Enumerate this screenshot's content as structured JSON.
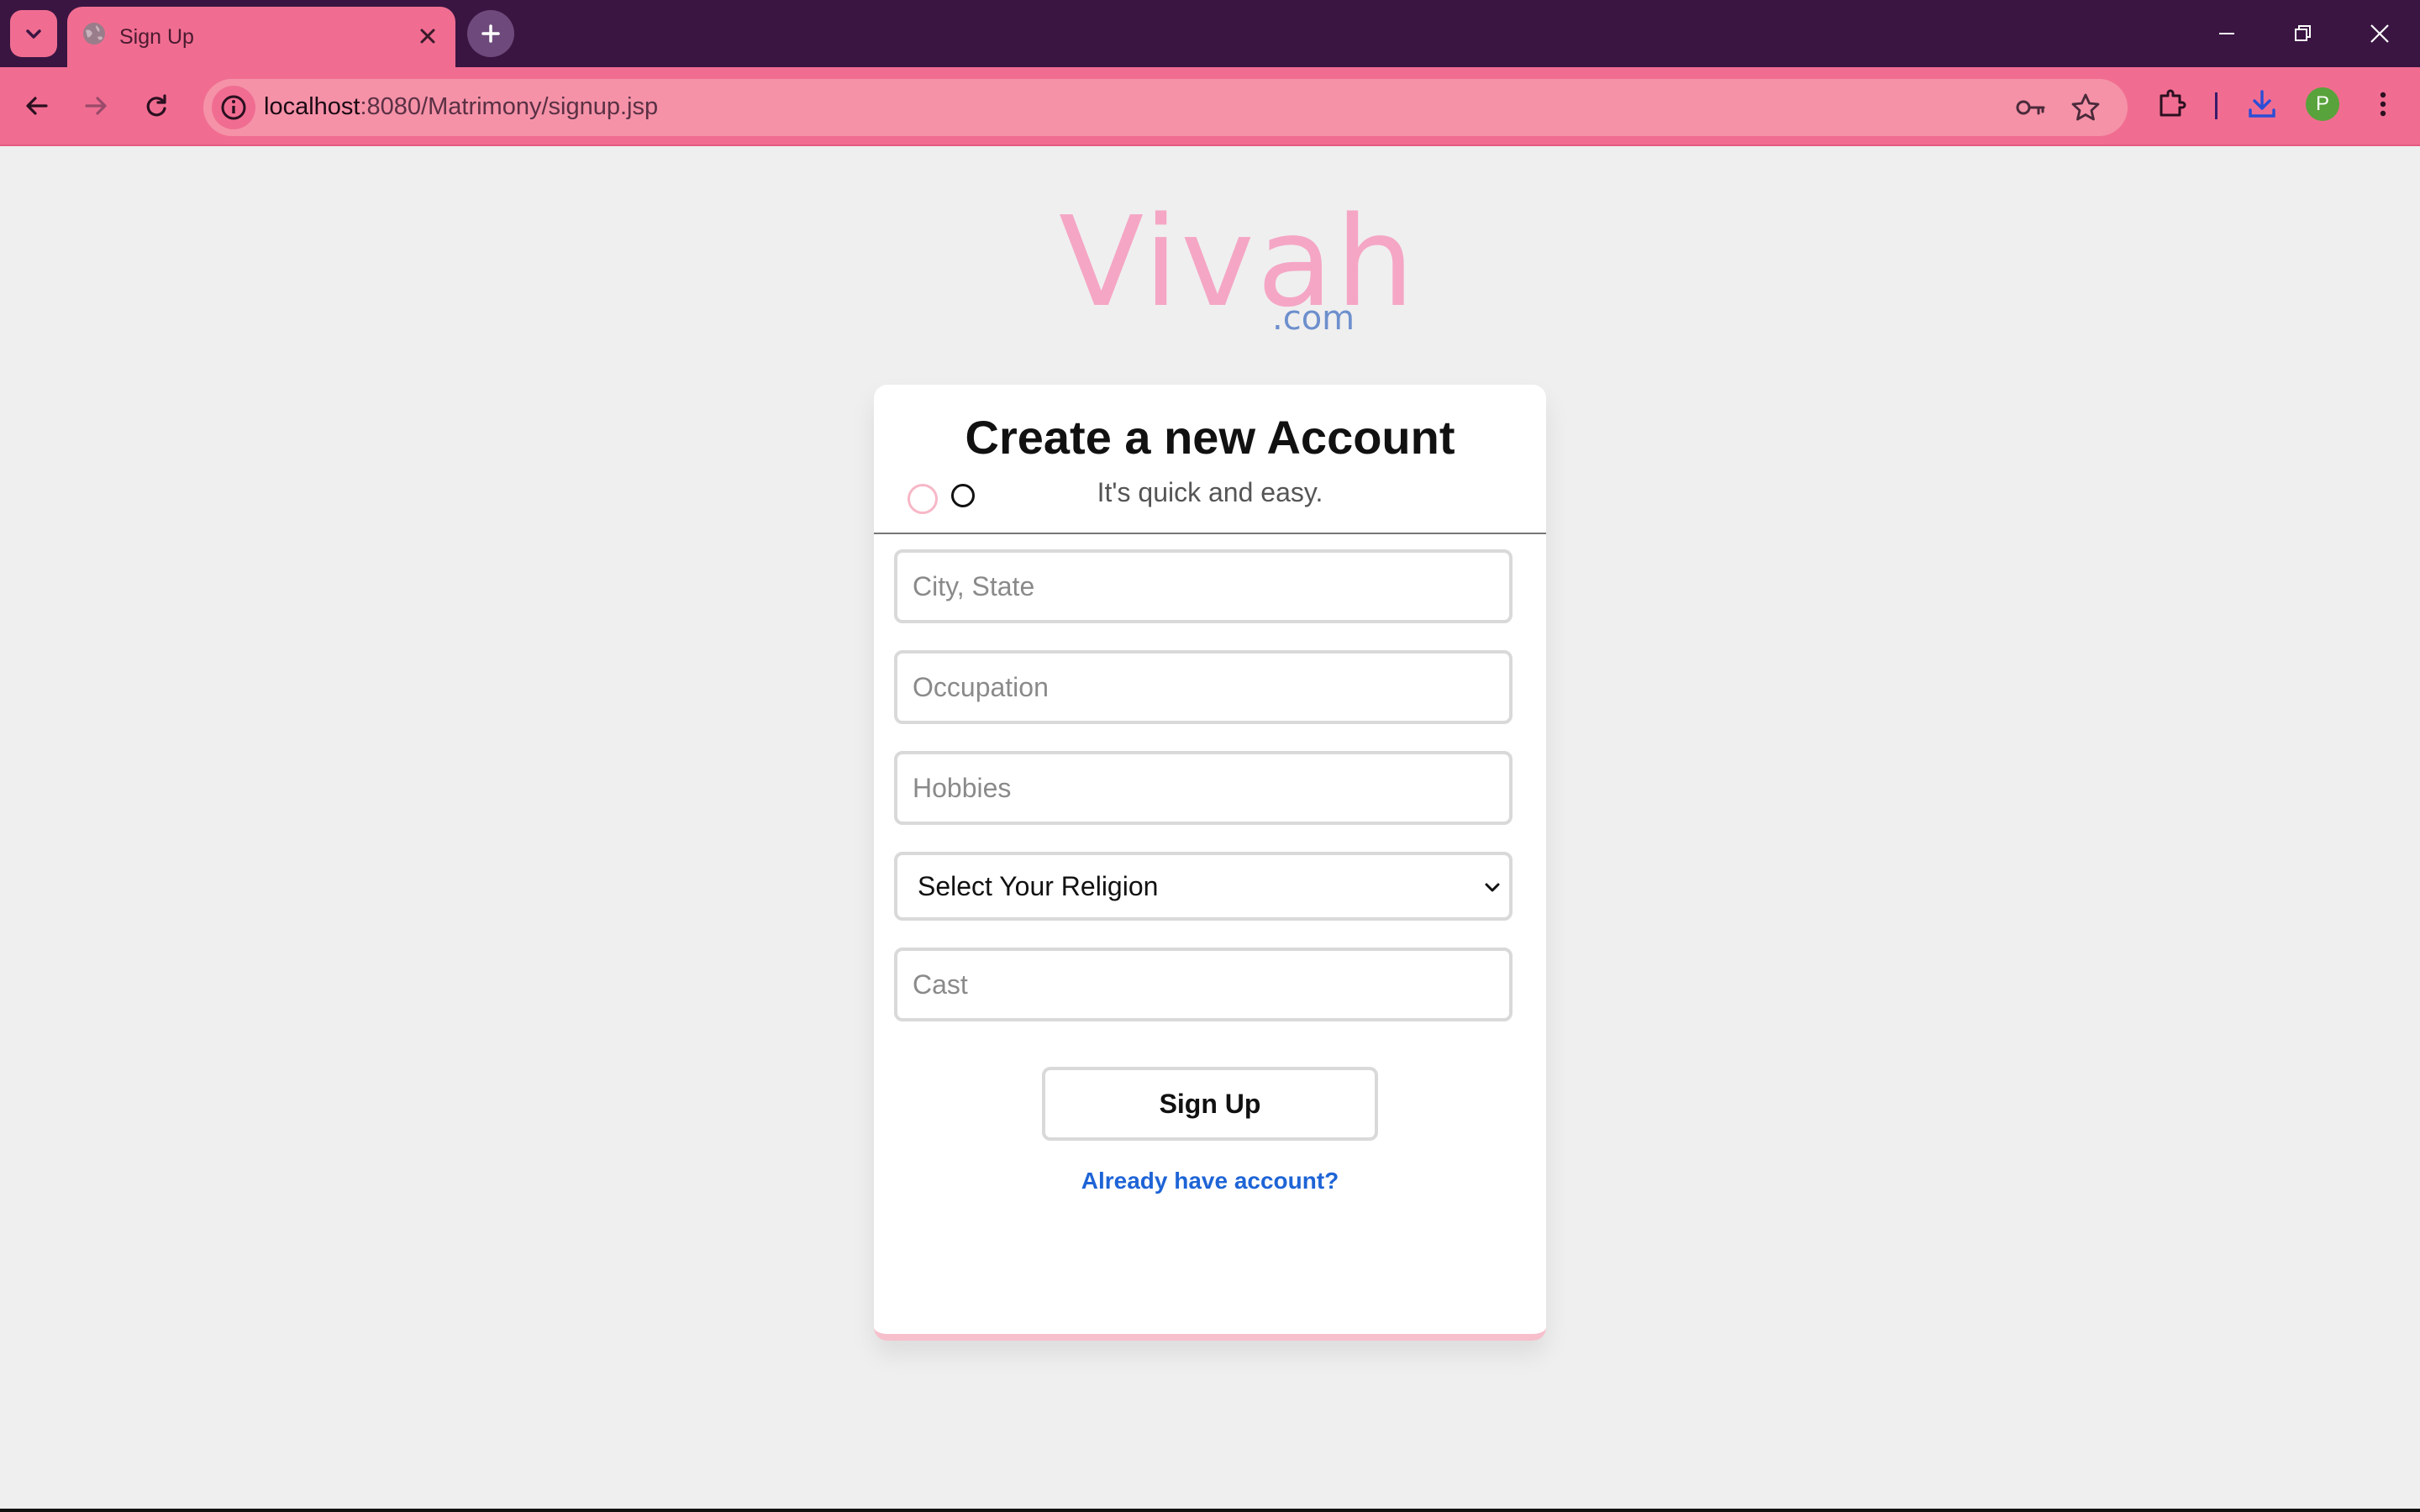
{
  "browser": {
    "tab_title": "Sign Up",
    "url_host": "localhost",
    "url_rest": ":8080/Matrimony/signup.jsp",
    "profile_initial": "P",
    "theme_colors": {
      "frame": "#3a1542",
      "toolbar": "#f06d91",
      "omnibox": "#f592a8"
    }
  },
  "logo": {
    "main": "Vivah",
    "suffix": ".com"
  },
  "form": {
    "title": "Create a new Account",
    "subtitle": "It's quick and easy.",
    "fields": {
      "city_placeholder": "City, State",
      "occupation_placeholder": "Occupation",
      "hobbies_placeholder": "Hobbies",
      "religion_selected": "Select Your Religion",
      "cast_placeholder": "Cast"
    },
    "submit_label": "Sign Up",
    "login_link": "Already have account?"
  },
  "colors": {
    "accent_pink": "#f5a6c5",
    "link_blue": "#1e64d6",
    "logo_suffix": "#6d8fcd"
  }
}
